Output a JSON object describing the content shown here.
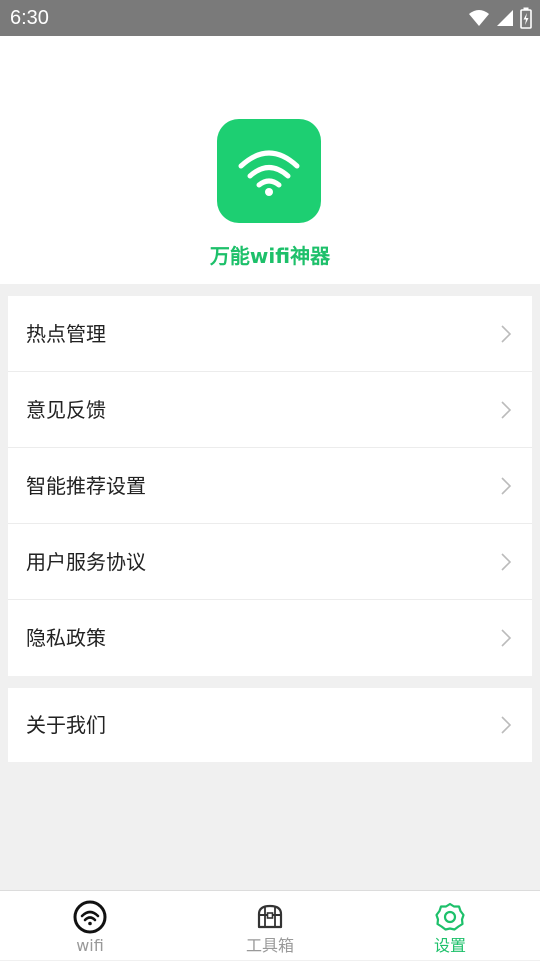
{
  "status_bar": {
    "time": "6:30",
    "icons": [
      "wifi-icon",
      "cell-signal-icon",
      "battery-icon"
    ]
  },
  "header": {
    "app_icon": "wifi-icon",
    "app_name": "万能wifi神器"
  },
  "menu": {
    "group_1": [
      {
        "label": "热点管理",
        "icon": "chevron-right-icon"
      },
      {
        "label": "意见反馈",
        "icon": "chevron-right-icon"
      },
      {
        "label": "智能推荐设置",
        "icon": "chevron-right-icon"
      },
      {
        "label": "用户服务协议",
        "icon": "chevron-right-icon"
      },
      {
        "label": "隐私政策",
        "icon": "chevron-right-icon"
      }
    ],
    "group_2": [
      {
        "label": "关于我们",
        "icon": "chevron-right-icon"
      }
    ]
  },
  "tab_bar": {
    "tabs": [
      {
        "label": "wifi",
        "icon": "wifi-circle-icon",
        "active": false
      },
      {
        "label": "工具箱",
        "icon": "toolbox-icon",
        "active": false
      },
      {
        "label": "设置",
        "icon": "settings-gear-icon",
        "active": true
      }
    ]
  },
  "colors": {
    "brand_green": "#1dcf72",
    "active_text": "#1dc06a",
    "status_bar_bg": "#7a7a7a",
    "page_bg": "#f0f0f0"
  }
}
